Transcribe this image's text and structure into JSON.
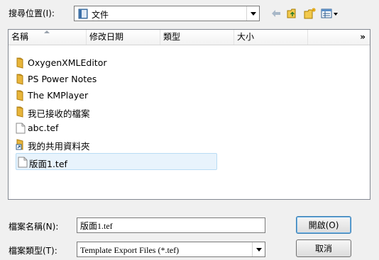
{
  "lookin": {
    "label": "搜尋位置(I):",
    "value": "文件"
  },
  "toolbar": {
    "back_icon": "back-arrow-icon",
    "up_icon": "up-folder-icon",
    "new_icon": "new-folder-icon",
    "view_icon": "view-menu-icon"
  },
  "columns": [
    "名稱",
    "修改日期",
    "類型",
    "大小"
  ],
  "more": "»",
  "items": [
    {
      "label": "OxygenXMLEditor",
      "icon": "folder-icon"
    },
    {
      "label": "PS Power Notes",
      "icon": "folder-icon"
    },
    {
      "label": "The KMPlayer",
      "icon": "folder-icon"
    },
    {
      "label": "我已接收的檔案",
      "icon": "folder-icon"
    },
    {
      "label": "abc.tef",
      "icon": "file-icon"
    },
    {
      "label": "我的共用資料夾",
      "icon": "shortcut-icon"
    },
    {
      "label": "版面1.tef",
      "icon": "file-icon"
    }
  ],
  "filename": {
    "label": "檔案名稱(N):",
    "value": "版面1.tef"
  },
  "filetype": {
    "label": "檔案類型(T):",
    "value": "Template Export Files (*.tef)"
  },
  "buttons": {
    "open": "開啟(O)",
    "cancel": "取消"
  },
  "colors": {
    "folder": "#e8b53a",
    "selection_bg": "#e8f3fc",
    "selection_border": "#b9dcf4"
  }
}
